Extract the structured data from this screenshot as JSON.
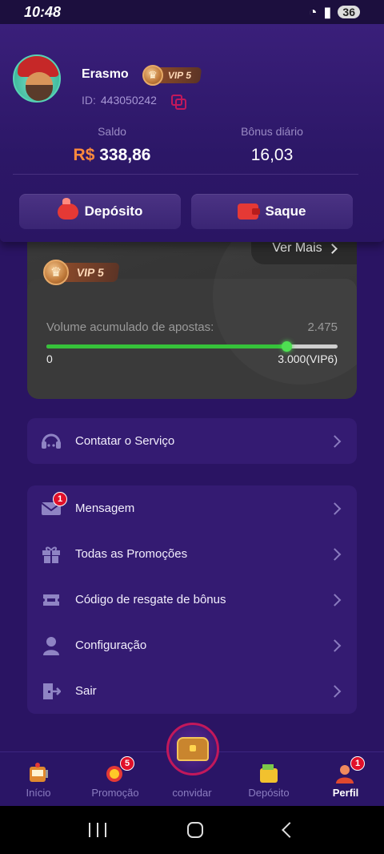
{
  "status_bar": {
    "time": "10:48",
    "battery": "36"
  },
  "profile": {
    "name": "Erasmo",
    "vip_level": "VIP 5",
    "id_label": "ID:",
    "id_value": "443050242"
  },
  "balance": {
    "saldo_label": "Saldo",
    "currency": "R$",
    "saldo_value": "338,86",
    "bonus_label": "Bônus diário",
    "bonus_value": "16,03"
  },
  "actions": {
    "deposit": "Depósito",
    "withdraw": "Saque"
  },
  "vip_card": {
    "ver_mais": "Ver Mais",
    "vip_level": "VIP 5",
    "volume_label": "Volume acumulado de apostas:",
    "volume_value": "2.475",
    "bar_min": "0",
    "bar_max": "3.000(VIP6)",
    "progress_fraction": 0.825
  },
  "service": {
    "label": "Contatar o Serviço"
  },
  "menu": [
    {
      "label": "Mensagem",
      "badge": "1"
    },
    {
      "label": "Todas as Promoções"
    },
    {
      "label": "Código de resgate de bônus"
    },
    {
      "label": "Configuração"
    },
    {
      "label": "Sair"
    }
  ],
  "tabs": [
    {
      "label": "Início"
    },
    {
      "label": "Promoção",
      "badge": "5"
    },
    {
      "label": "convidar"
    },
    {
      "label": "Depósito"
    },
    {
      "label": "Perfil",
      "badge": "1"
    }
  ],
  "colors": {
    "accent": "#ff8a3d",
    "progress": "#36c23a",
    "badge": "#e0102a"
  }
}
